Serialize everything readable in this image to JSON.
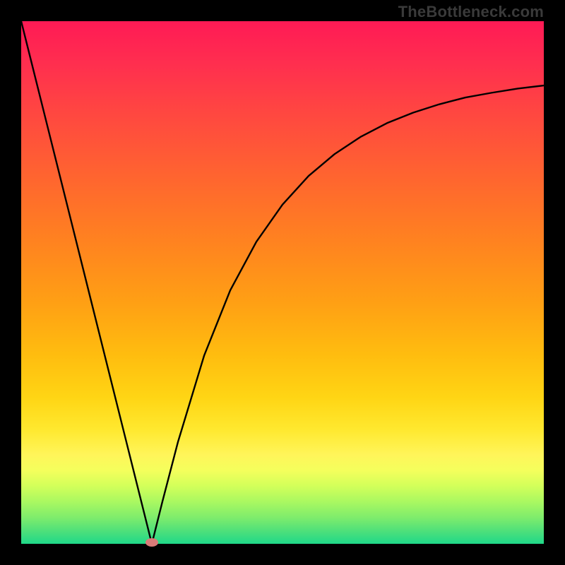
{
  "watermark": "TheBottleneck.com",
  "chart_data": {
    "type": "line",
    "title": "",
    "xlabel": "",
    "ylabel": "",
    "xlim": [
      0,
      1
    ],
    "ylim": [
      0,
      1
    ],
    "grid": false,
    "legend": false,
    "series": [
      {
        "name": "bottleneck-curve",
        "description": "V-shaped curve: steep linear descent from top-left to a minimum near x≈0.25, then a concave ascent approaching an asymptote near y≈0.9 at the right edge.",
        "x": [
          0.0,
          0.05,
          0.1,
          0.15,
          0.2,
          0.23,
          0.25,
          0.27,
          0.3,
          0.35,
          0.4,
          0.45,
          0.5,
          0.55,
          0.6,
          0.65,
          0.7,
          0.75,
          0.8,
          0.85,
          0.9,
          0.95,
          1.0
        ],
        "y": [
          1.0,
          0.8,
          0.6,
          0.4,
          0.2,
          0.08,
          0.0,
          0.08,
          0.195,
          0.36,
          0.485,
          0.578,
          0.649,
          0.704,
          0.746,
          0.779,
          0.805,
          0.825,
          0.841,
          0.854,
          0.863,
          0.871,
          0.877
        ]
      }
    ],
    "annotations": [
      {
        "name": "minimum-marker",
        "type": "point",
        "x": 0.25,
        "y": 0.0,
        "color": "#d97b78"
      }
    ],
    "background_gradient": {
      "direction": "vertical",
      "stops": [
        {
          "pos": 0.0,
          "color": "#ff1a55"
        },
        {
          "pos": 0.5,
          "color": "#ff9a16"
        },
        {
          "pos": 0.8,
          "color": "#ffe82e"
        },
        {
          "pos": 1.0,
          "color": "#1fd889"
        }
      ]
    }
  }
}
